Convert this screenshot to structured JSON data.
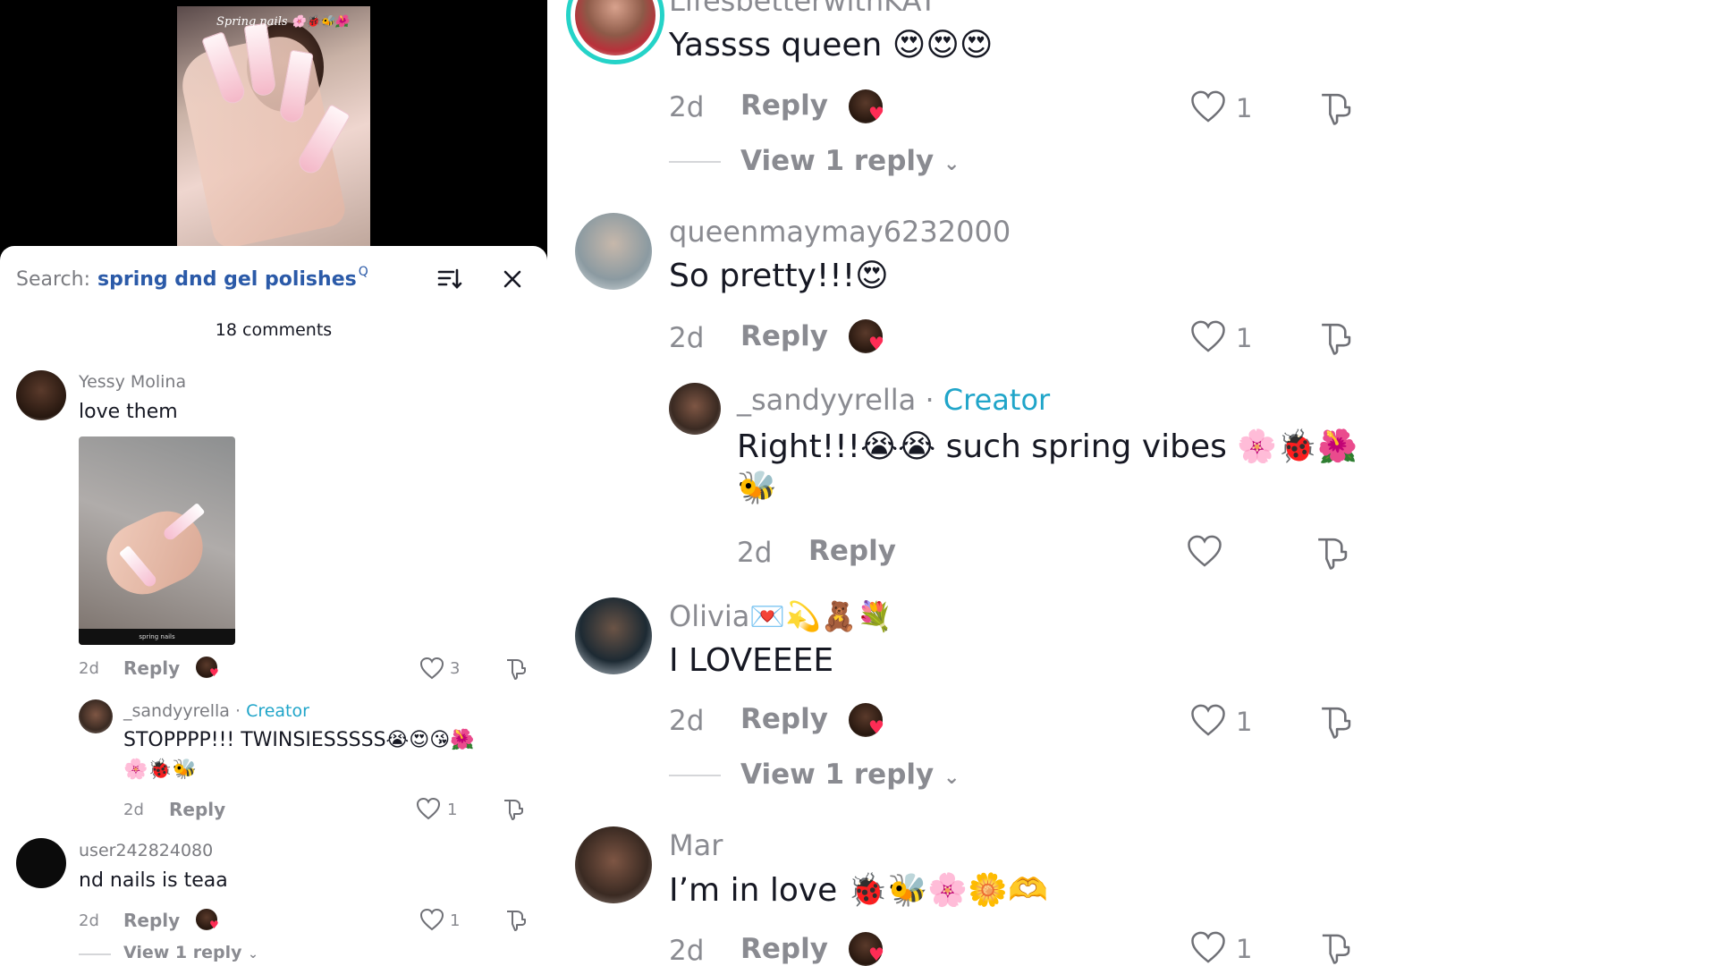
{
  "video": {
    "caption": "Spring nails 🌸🐞🐝🌺"
  },
  "search": {
    "prefix": "Search:",
    "term": "spring dnd gel polishes",
    "mini": "Q"
  },
  "comments_count": "18 comments",
  "left_comments": [
    {
      "user": "Yessy Molina",
      "text": "love them",
      "time": "2d",
      "reply": "Reply",
      "likes": "3",
      "image_label": "spring nails"
    },
    {
      "user": "_sandyyrella",
      "badge": "Creator",
      "sep": "·",
      "text": "STOPPPP!!! TWINSIESSSSS😭😍😘🌺",
      "text2": "🌸🐞🐝",
      "time": "2d",
      "reply": "Reply",
      "likes": "1"
    },
    {
      "user": "user242824080",
      "text": "nd nails is teaa",
      "time": "2d",
      "reply": "Reply",
      "likes": "1",
      "view_replies": "View 1 reply"
    }
  ],
  "right_comments": [
    {
      "user": "LifesbetterwithKAT",
      "text": "Yassss queen 😍😍😍",
      "time": "2d",
      "reply": "Reply",
      "likes": "1",
      "view_replies": "View 1 reply"
    },
    {
      "user": "queenmaymay6232000",
      "text": "So pretty!!!😍",
      "time": "2d",
      "reply": "Reply",
      "likes": "1"
    },
    {
      "user": "_sandyyrella",
      "sep": "·",
      "badge": "Creator",
      "text": "Right!!!😭😭 such spring vibes 🌸🐞🌺",
      "text2": "🐝",
      "time": "2d",
      "reply": "Reply"
    },
    {
      "user": "Olivia💌💫🧸💐",
      "text": "I LOVEEEE",
      "time": "2d",
      "reply": "Reply",
      "likes": "1",
      "view_replies": "View 1 reply"
    },
    {
      "user": "Mar",
      "text": "I’m in love 🐞🐝🌸🌼🫶",
      "time": "2d",
      "reply": "Reply",
      "likes": "1"
    }
  ],
  "colors": {
    "creator": "#20a5c9",
    "search_term": "#2b5aa8",
    "heart_badge": "#fe2c55",
    "ring": "#25d3c8"
  },
  "icons": [
    "sort-icon",
    "close-icon",
    "heart-icon",
    "dislike-icon",
    "chevron-down-icon"
  ]
}
